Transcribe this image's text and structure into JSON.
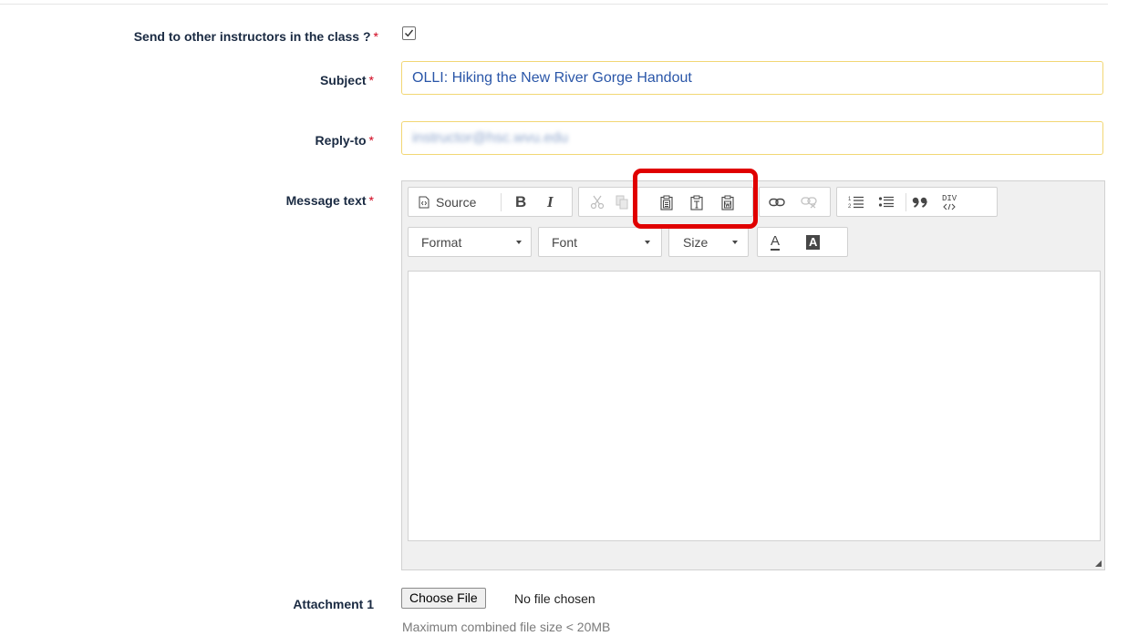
{
  "form": {
    "send_to_instructors": {
      "label": "Send to other instructors in the class ?",
      "required_mark": "*",
      "checked": true
    },
    "subject": {
      "label": "Subject",
      "required_mark": "*",
      "value": "OLLI: Hiking the New River Gorge Handout"
    },
    "reply_to": {
      "label": "Reply-to",
      "required_mark": "*",
      "value": "instructor@hsc.wvu.edu"
    },
    "message": {
      "label": "Message text",
      "required_mark": "*"
    },
    "attachment": {
      "label": "Attachment 1",
      "button_label": "Choose File",
      "status": "No file chosen",
      "hint": "Maximum combined file size < 20MB"
    }
  },
  "editor": {
    "source_label": "Source",
    "bold_label": "B",
    "italic_label": "I",
    "format_label": "Format",
    "font_label": "Font",
    "size_label": "Size",
    "text_color_glyph": "A",
    "bg_color_glyph": "A",
    "div_glyph_top": "DIV"
  },
  "colors": {
    "highlight": "#e00000",
    "field_border": "#f2d774",
    "required": "#d0021b"
  }
}
